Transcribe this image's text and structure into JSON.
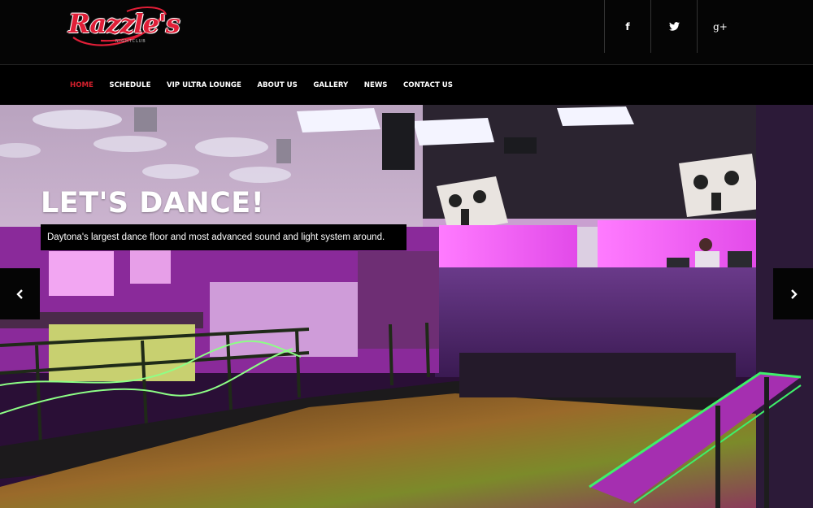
{
  "header": {
    "logo": {
      "text": "Razzle's",
      "subtext": "NIGHTCLUB"
    },
    "social": [
      {
        "icon": "facebook-icon",
        "label": "f"
      },
      {
        "icon": "twitter-icon",
        "label": ""
      },
      {
        "icon": "google-plus-icon",
        "label": "g+"
      }
    ]
  },
  "nav": {
    "items": [
      {
        "label": "HOME",
        "active": true
      },
      {
        "label": "SCHEDULE",
        "active": false
      },
      {
        "label": "VIP ULTRA LOUNGE",
        "active": false
      },
      {
        "label": "ABOUT US",
        "active": false
      },
      {
        "label": "GALLERY",
        "active": false
      },
      {
        "label": "NEWS",
        "active": false
      },
      {
        "label": "CONTACT US",
        "active": false
      }
    ]
  },
  "hero": {
    "title": "LET'S DANCE!",
    "caption": "Daytona's largest dance floor and most advanced sound and light system around.",
    "prev_icon": "chevron-left-icon",
    "next_icon": "chevron-right-icon"
  },
  "colors": {
    "brand": "#e01e37",
    "active_nav": "#d3202c",
    "header_bg": "#050505",
    "nav_bg": "#000000"
  }
}
